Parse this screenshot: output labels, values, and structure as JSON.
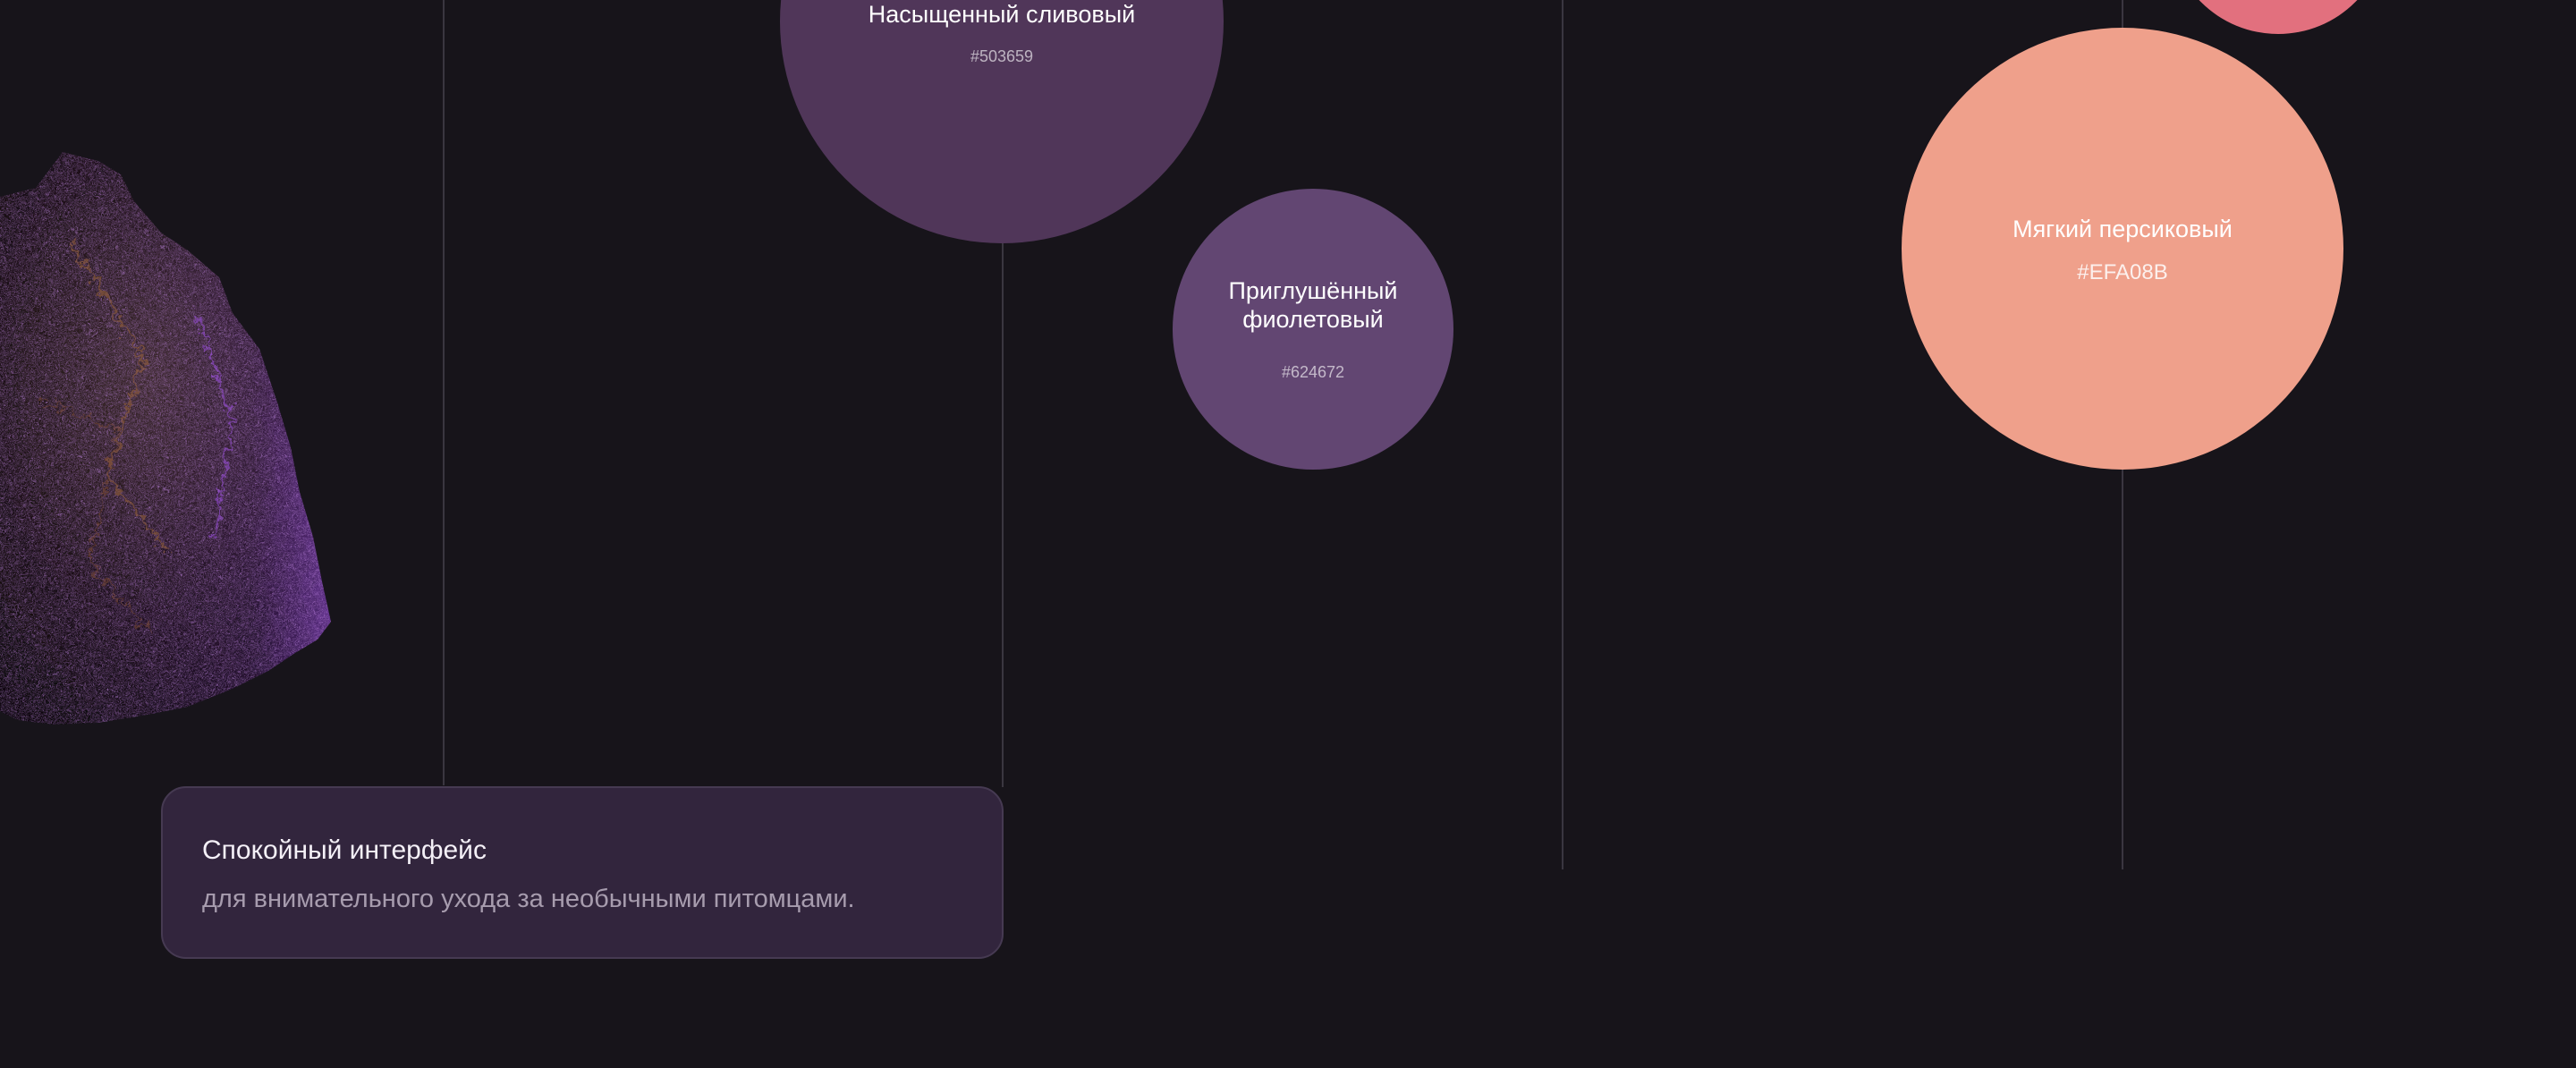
{
  "swatches": [
    {
      "name": "Насыщенный сливовый",
      "hex_label": "#503659",
      "color": "#503659"
    },
    {
      "name": "Приглушённый фиолетовый",
      "name_lines": [
        "Приглушённый",
        "фиолетовый"
      ],
      "hex_label": "#624672",
      "color": "#624672"
    },
    {
      "name": "Мягкий персиковый",
      "hex_label": "#EFA08B",
      "color": "#EFA08B"
    },
    {
      "color": "#E2707E"
    }
  ],
  "info_card": {
    "title": "Спокойный интерфейс",
    "subtitle": "для внимательного ухода за необычными питомцами."
  },
  "colors": {
    "background": "#17141a",
    "line": "#3a3640",
    "card_background": "#32253d",
    "card_border": "#463a52",
    "rock_purple": "#8e3fd0",
    "rock_copper": "#8a5a3c"
  },
  "decorations": {
    "rock_image": "textured-purple-rock"
  }
}
